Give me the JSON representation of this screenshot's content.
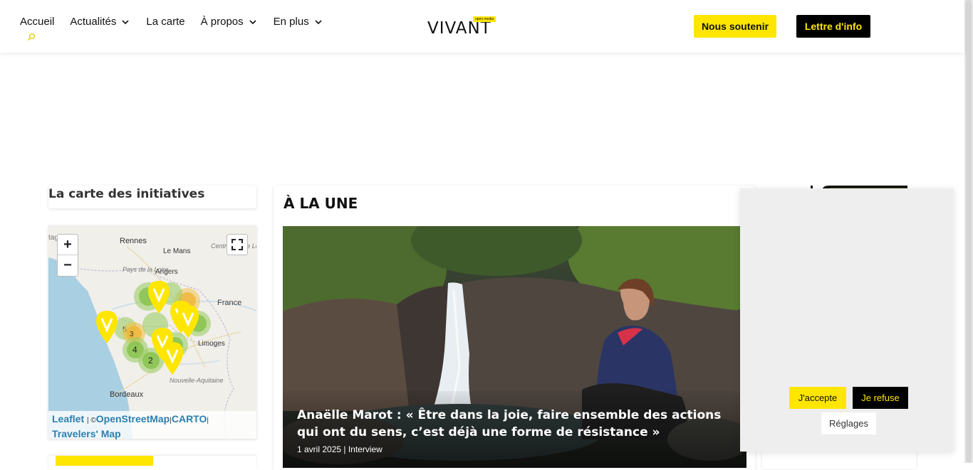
{
  "header": {
    "nav": [
      {
        "label": "Accueil",
        "has_dropdown": false
      },
      {
        "label": "Actualités",
        "has_dropdown": true
      },
      {
        "label": "La carte",
        "has_dropdown": false
      },
      {
        "label": "À propos",
        "has_dropdown": true
      },
      {
        "label": "En plus",
        "has_dropdown": true
      }
    ],
    "logo_text": "VIVANT",
    "logo_tag": "open media",
    "support_label": "Nous soutenir",
    "newsletter_label": "Lettre d'info"
  },
  "sidebar": {
    "map_title": "La carte des initiatives",
    "map": {
      "zoom_in": "+",
      "zoom_out": "−",
      "places": [
        "Rennes",
        "Le Mans",
        "Angers",
        "Pays de la Loire",
        "Centre-Val de Loire",
        "France",
        "Limoges",
        "Bordeaux",
        "Nouvelle-Aquitaine",
        "tagne"
      ],
      "cluster_counts": [
        "4",
        "2",
        "5",
        "2",
        "3"
      ],
      "attribution": {
        "leaflet": "Leaflet",
        "copyright": "| ©",
        "osm": "OpenStreetMap",
        "sep": "|",
        "carto": "CARTO",
        "sep2": "|",
        "travelers": "Travelers' Map"
      }
    }
  },
  "une": {
    "title": "À LA UNE",
    "headline": "Anaëlle Marot : « Être dans la joie, faire ensemble des actions qui ont du sens, c’est déjà une forme de résistance »",
    "meta": "1 avril 2025 | Interview"
  },
  "cookie": {
    "accept_label": "J'accepte",
    "refuse_label": "Je refuse",
    "settings_label": "Réglages"
  },
  "colors": {
    "accent": "#ffe600",
    "dark": "#000000"
  }
}
